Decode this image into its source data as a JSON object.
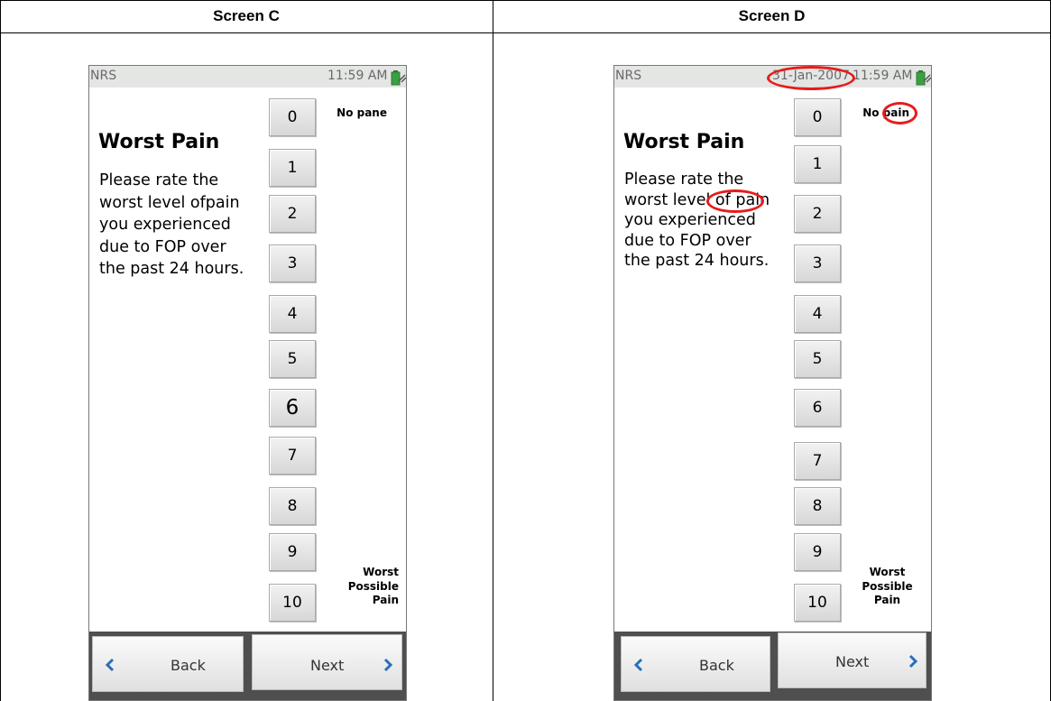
{
  "screens": [
    {
      "heading": "Screen C",
      "app_label": "NRS",
      "date": "",
      "time": "11:59 AM",
      "title": "Worst Pain",
      "question_lines": [
        "Please rate the",
        "worst level ofpain",
        "you experienced",
        "due to FOP over",
        "the past 24 hours."
      ],
      "numbers": [
        "0",
        "1",
        "2",
        "3",
        "4",
        "5",
        "6",
        "7",
        "8",
        "9",
        "10"
      ],
      "anchor_top": "No pane",
      "anchor_bottom_lines": [
        "Worst",
        "Possible",
        "Pain"
      ],
      "back_label": "Back",
      "next_label": "Next"
    },
    {
      "heading": "Screen D",
      "app_label": "NRS",
      "date": "31-Jan-2007",
      "time": "11:59 AM",
      "title": "Worst Pain",
      "question_lines": [
        "Please rate the",
        "worst level of pain",
        "you experienced",
        "due to FOP over",
        "the past 24 hours."
      ],
      "numbers": [
        "0",
        "1",
        "2",
        "3",
        "4",
        "5",
        "6",
        "7",
        "8",
        "9",
        "10"
      ],
      "anchor_top": "No pain",
      "anchor_bottom_lines": [
        "Worst",
        "Possible",
        "Pain"
      ],
      "back_label": "Back",
      "next_label": "Next"
    }
  ],
  "colors": {
    "annotation": "#e51c1c",
    "chevron": "#2a6fb8",
    "battery": "#3aa043"
  }
}
